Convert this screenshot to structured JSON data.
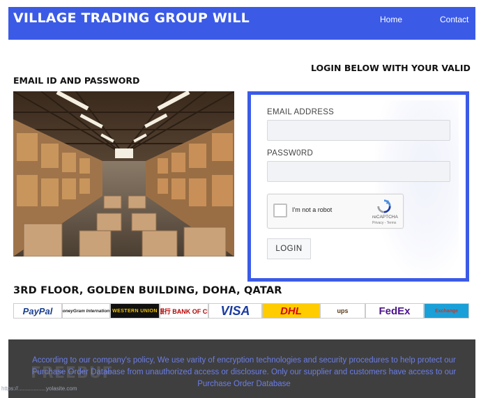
{
  "header": {
    "title": "VILLAGE TRADING GROUP WILL",
    "nav": [
      {
        "label": "Home"
      },
      {
        "label": "Contact"
      }
    ],
    "color": "#3b5be6"
  },
  "intro": {
    "line1": "LOGIN BELOW WITH YOUR VALID",
    "line2": "EMAIL ID AND PASSWORD"
  },
  "login": {
    "email_label": "EMAIL ADDRESS",
    "email_value": "",
    "password_label": "PASSW0RD",
    "password_value": "",
    "captcha": {
      "label": "I'm not a robot",
      "brand": "reCAPTCHA",
      "terms": "Privacy - Terms",
      "checked": false
    },
    "button_label": "LOGIN"
  },
  "address": "3RD FLOOR, GOLDEN BUILDING, DOHA, QATAR",
  "payment_logos": [
    "PayPal",
    "MoneyGram International",
    "WESTERN UNION",
    "中国银行 BANK OF CHINA",
    "VISA",
    "DHL",
    "ups",
    "FedEx",
    "Exchange"
  ],
  "footer": {
    "policy": "According to our company's policy, We use varity of encryption technologies and security procedures to help protect our Purchase Order Database from unauthorized access or disclosure. Only our supplier and customers have access to our Purchase Order Database",
    "url": "https://..................yolasite.com",
    "watermark": "FREEBUF"
  },
  "icons": [
    "recaptcha-logo-icon",
    "warehouse-photo"
  ]
}
